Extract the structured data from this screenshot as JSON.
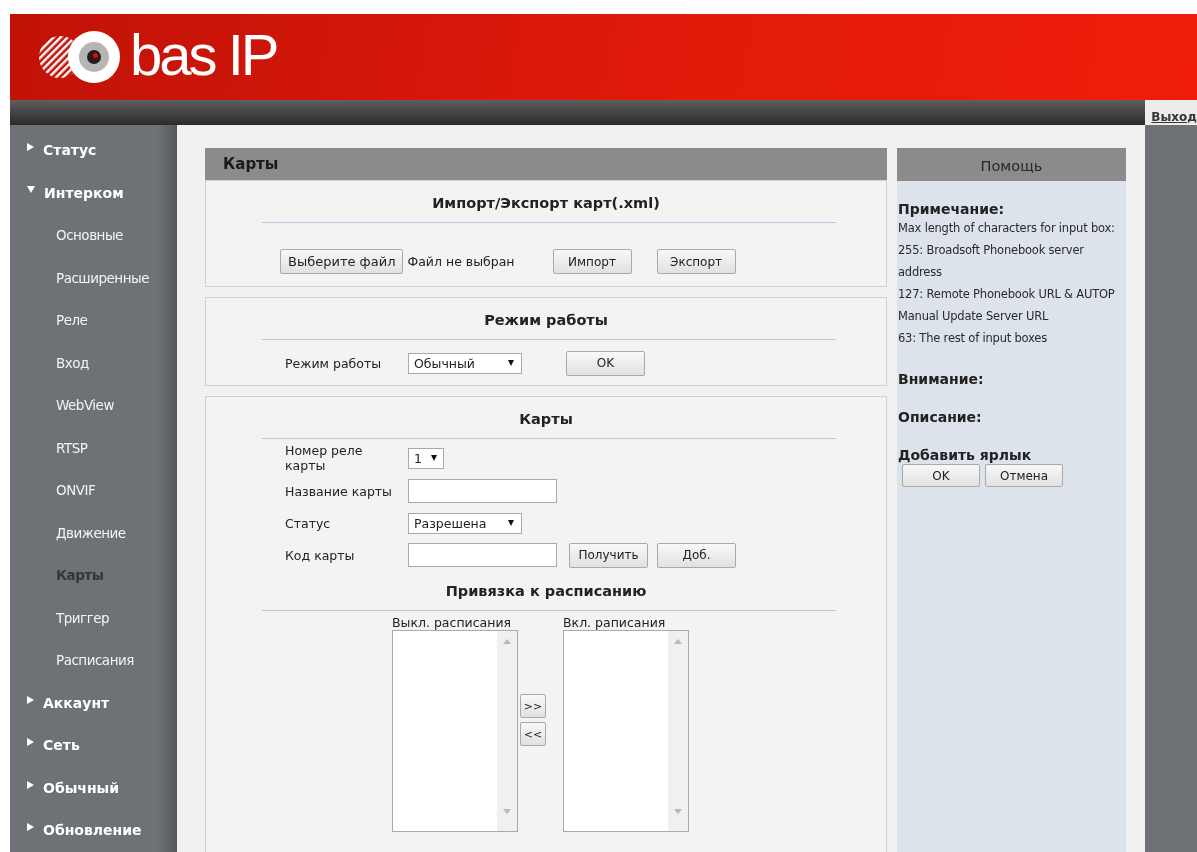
{
  "header": {
    "logo_text": "bas IP"
  },
  "topbar": {
    "logout": "Выход"
  },
  "sidebar": {
    "items": [
      {
        "label": "Статус",
        "expanded": false
      },
      {
        "label": "Интерком",
        "expanded": true,
        "children": [
          {
            "label": "Основные",
            "selected": false
          },
          {
            "label": "Расширенные",
            "selected": false
          },
          {
            "label": "Реле",
            "selected": false
          },
          {
            "label": "Вход",
            "selected": false
          },
          {
            "label": "WebView",
            "selected": false
          },
          {
            "label": "RTSP",
            "selected": false
          },
          {
            "label": "ONVIF",
            "selected": false
          },
          {
            "label": "Движение",
            "selected": false
          },
          {
            "label": "Карты",
            "selected": true
          },
          {
            "label": "Триггер",
            "selected": false
          },
          {
            "label": "Расписания",
            "selected": false
          }
        ]
      },
      {
        "label": "Аккаунт",
        "expanded": false
      },
      {
        "label": "Сеть",
        "expanded": false
      },
      {
        "label": "Обычный",
        "expanded": false
      },
      {
        "label": "Обновление",
        "expanded": false
      }
    ]
  },
  "main": {
    "title": "Карты",
    "sections": [
      {
        "kind": "import_export",
        "title": "Импорт/Экспорт карт(.xml)",
        "file_button": "Выберите файл",
        "file_status": "Файл не выбран",
        "buttons": [
          "Импорт",
          "Экспорт"
        ]
      },
      {
        "kind": "mode",
        "title": "Режим работы",
        "label": "Режим работы",
        "select": "Обычный",
        "button": "OK"
      },
      {
        "kind": "cards",
        "title": "Карты",
        "fields": [
          {
            "kind": "select",
            "label": "Номер реле карты",
            "value": "1"
          },
          {
            "kind": "text",
            "label": "Название карты"
          },
          {
            "kind": "select",
            "label": "Статус",
            "value": "Разрешена"
          },
          {
            "kind": "text",
            "label": "Код карты",
            "buttons": [
              "Получить",
              "Доб."
            ]
          }
        ],
        "schedule": {
          "title": "Привязка к расписанию",
          "off_label": "Выкл. расписания",
          "on_label": "Вкл. раписания",
          "move_buttons": [
            ">>",
            "<<"
          ]
        }
      }
    ]
  },
  "help": {
    "title": "Помощь",
    "sections": [
      {
        "heading": "Примечание:",
        "lines": [
          "Max length of characters for input box:",
          "255: Broadsoft Phonebook server address",
          "127: Remote Phonebook URL & AUTOP Manual Update Server URL",
          "63: The rest of input boxes"
        ]
      },
      {
        "heading": "Внимание:"
      },
      {
        "heading": "Описание:"
      },
      {
        "heading": "Добавить ярлык"
      }
    ],
    "buttons": [
      "OK",
      "Отмена"
    ]
  }
}
